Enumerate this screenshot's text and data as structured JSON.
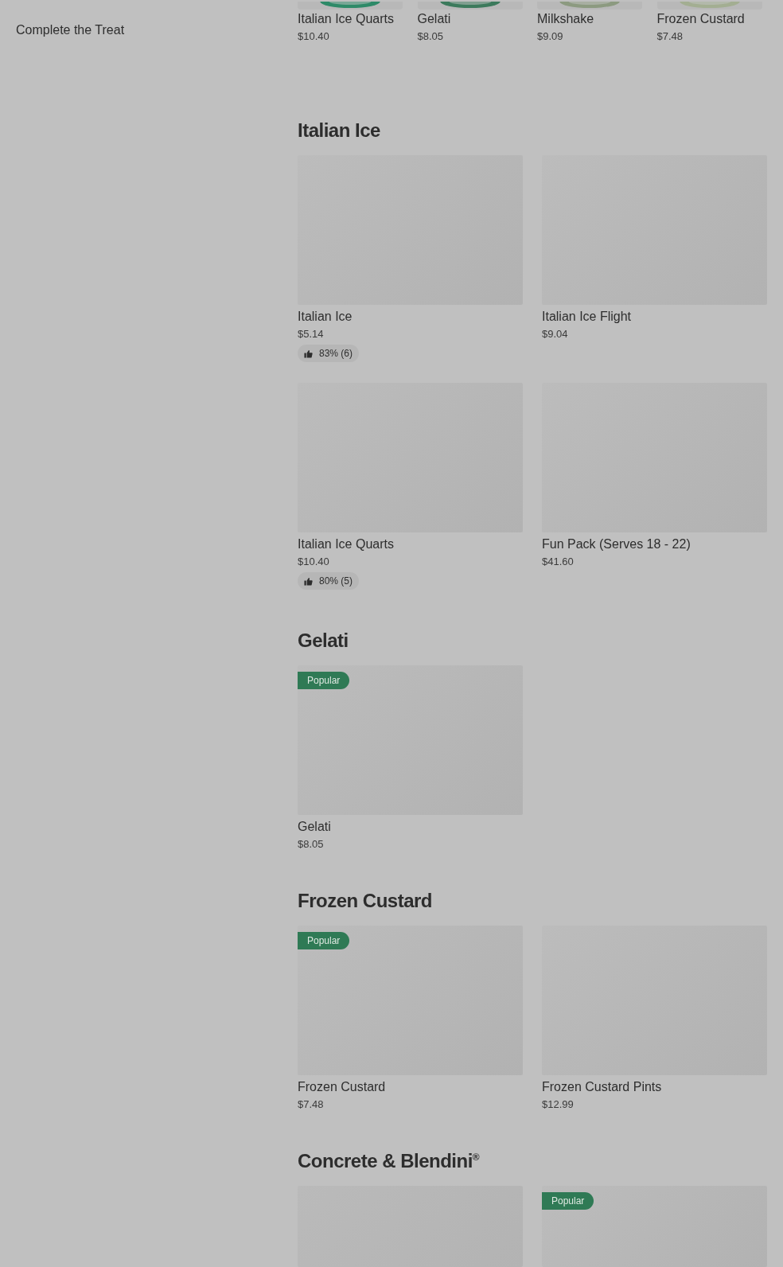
{
  "sidebar": {
    "items": [
      {
        "label": "Complete the Treat"
      }
    ]
  },
  "featured": [
    {
      "name": "Italian Ice Quarts",
      "price": "$10.40"
    },
    {
      "name": "Gelati",
      "price": "$8.05"
    },
    {
      "name": "Milkshake",
      "price": "$9.09"
    },
    {
      "name": "Frozen Custard",
      "price": "$7.48"
    }
  ],
  "sections": [
    {
      "title": "Italian Ice",
      "items": [
        {
          "name": "Italian Ice",
          "price": "$5.14",
          "rating": "83% (6)"
        },
        {
          "name": "Italian Ice Flight",
          "price": "$9.04"
        },
        {
          "name": "Italian Ice Quarts",
          "price": "$10.40",
          "rating": "80% (5)"
        },
        {
          "name": "Fun Pack (Serves 18 - 22)",
          "price": "$41.60"
        }
      ]
    },
    {
      "title": "Gelati",
      "items": [
        {
          "name": "Gelati",
          "price": "$8.05",
          "badge": "Popular"
        }
      ]
    },
    {
      "title": "Frozen Custard",
      "items": [
        {
          "name": "Frozen Custard",
          "price": "$7.48",
          "badge": "Popular"
        },
        {
          "name": "Frozen Custard Pints",
          "price": "$12.99"
        }
      ]
    },
    {
      "title": "Concrete & Blendini$^{®}$",
      "items": [
        {
          "kind": "picture"
        },
        {
          "badge": "Popular"
        }
      ]
    }
  ]
}
